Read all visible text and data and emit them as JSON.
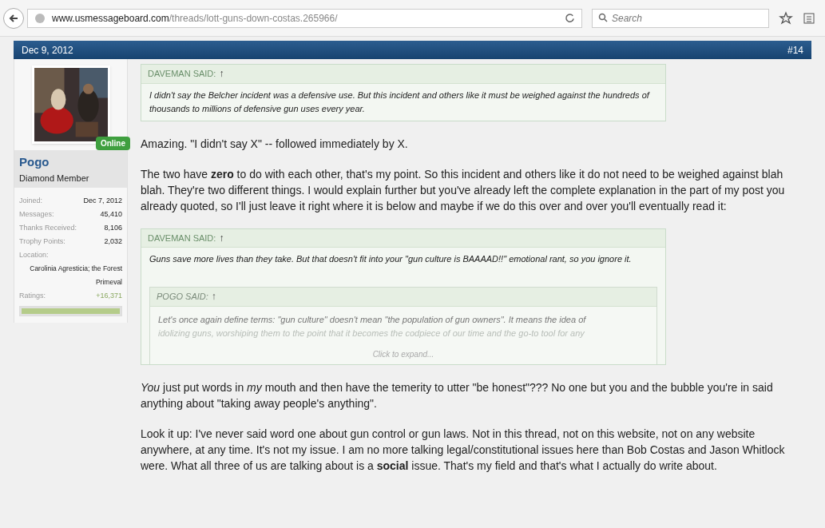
{
  "browser": {
    "url_host": "www.usmessageboard.com",
    "url_path": "/threads/lott-guns-down-costas.265966/",
    "search": {
      "placeholder": "Search"
    }
  },
  "post": {
    "date": "Dec 9, 2012",
    "number": "#14",
    "author": {
      "name": "Pogo",
      "title": "Diamond Member",
      "status": "Online",
      "stats": [
        {
          "label": "Joined:",
          "value": "Dec 7, 2012"
        },
        {
          "label": "Messages:",
          "value": "45,410"
        },
        {
          "label": "Thanks Received:",
          "value": "8,106"
        },
        {
          "label": "Trophy Points:",
          "value": "2,032"
        }
      ],
      "location_label": "Location:",
      "location": "Carolinia Agresticia; the Forest Primeval",
      "ratings_label": "Ratings:",
      "ratings": "+16,371",
      "ratings_bar": {
        "level": 1
      }
    },
    "body": [
      {
        "kind": "quote",
        "author": "DAVEMAN SAID:",
        "arrow": "↑",
        "text": "I didn't say the Belcher incident was a defensive use. But this incident and others like it must be weighed against the hundreds of thousands to millions of defensive gun uses every year."
      },
      {
        "kind": "para",
        "text": "Amazing. \"I didn't say X\" -- followed immediately by X."
      },
      {
        "kind": "para",
        "text": "The two have **zero** to do with each other, that's my point. So this incident and others like it do not need to be weighed against blah blah. They're two different things. I would explain further but you've already left the complete explanation in the part of my post you already quoted, so I'll just leave it right where it is below and maybe if we do this over and over you'll eventually read it:"
      },
      {
        "kind": "quote",
        "author": "DAVEMAN SAID:",
        "arrow": "↑",
        "text": "Guns save more lives than they take. But that doesn't fit into your \"gun culture is BAAAAD!!\" emotional rant, so you ignore it.",
        "nested": {
          "author": "POGO SAID:",
          "arrow": "↑",
          "lines": [
            "Let's once again define terms: \"gun culture\" doesn't mean \"the population of gun owners\". It means the idea of",
            "idolizing guns, worshiping them to the point that it becomes the codpiece of our time and the go-to tool for any"
          ],
          "expand": "Click to expand..."
        }
      },
      {
        "kind": "para",
        "text": "*You* just put words in *my* mouth and then have the temerity to utter \"be honest\"??? No one but you and the bubble you're in said anything about \"taking away people's anything\"."
      },
      {
        "kind": "para",
        "text": "Look it up: I've never said word one about gun control or gun laws. Not in this thread, not on this website, not on any website anywhere, at any time. It's not my issue. I am no more talking legal/constitutional issues here than Bob Costas and Jason Whitlock were. What all three of us are talking about is a **social** issue. That's my field and that's what I actually do write about."
      }
    ]
  }
}
